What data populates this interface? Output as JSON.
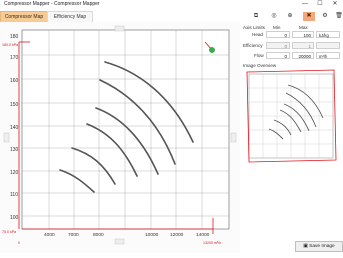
{
  "window": {
    "title": "Compressor Mapper - Compressor Mapper",
    "minimize": "—",
    "maximize": "☐",
    "close": "✕"
  },
  "tabs": [
    {
      "label": "Compressor Map"
    },
    {
      "label": "Efficiency Map"
    }
  ],
  "toolbar": [
    {
      "icon": "crop-icon",
      "glyph": "⧉"
    },
    {
      "icon": "target-icon",
      "glyph": "◎"
    },
    {
      "icon": "zoom-icon",
      "glyph": "⊕"
    },
    {
      "icon": "cross-tool-icon",
      "glyph": "✖"
    },
    {
      "icon": "settings-icon",
      "glyph": "⚙"
    },
    {
      "icon": "delete-icon",
      "glyph": "🗑"
    }
  ],
  "axis_limits": {
    "heading": "Axis Limits",
    "min_header": "Min",
    "max_header": "Max",
    "rows": [
      {
        "label": "Head",
        "min": "0",
        "max": "100",
        "unit": "kJ/kg"
      },
      {
        "label": "Efficiency",
        "min": "0",
        "max": "1",
        "unit": ""
      },
      {
        "label": "Flow",
        "min": "0",
        "max": "20000",
        "unit": "m³/h"
      }
    ]
  },
  "overview": {
    "heading": "Image Overview"
  },
  "save_button": {
    "label": "Save Image"
  },
  "plot": {
    "y_ticks": [
      "180",
      "170",
      "160",
      "150",
      "140",
      "130",
      "120",
      "110",
      "100"
    ],
    "x_ticks": [
      "2000",
      "4000",
      "6000",
      "8000",
      "10000",
      "12000"
    ],
    "x_ticks_partial": [
      "4000",
      "7000",
      "8000",
      "10000",
      "12000",
      "14000"
    ],
    "red_y_min_label": "75.0 kPa",
    "red_y_max_label": "180.0 kPa",
    "red_x_min_label": "0",
    "red_x_max_label": "13200 m³/h"
  },
  "colors": {
    "tab_active": "#f6cb95",
    "tool_active": "#f4a77b",
    "axis_red": "#e0141e",
    "curve": "#555555"
  }
}
